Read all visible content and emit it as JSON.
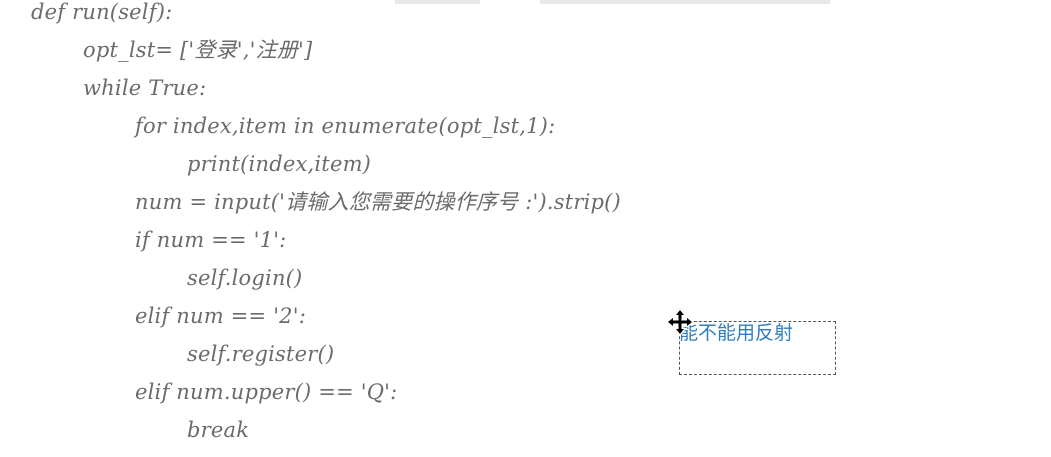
{
  "code_lines": [
    "def run(self):",
    "opt_lst= ['登录','注册']",
    "while True:",
    "for index,item in enumerate(opt_lst,1):",
    "print(index,item)",
    "num = input('请输入您需要的操作序号 :').strip()",
    "if num == '1':",
    "self.login()",
    "elif num == '2':",
    "self.register()",
    "elif num.upper() == 'Q':",
    "break"
  ],
  "annotation": {
    "text": "能不能用反射"
  },
  "icons": {
    "cursor": "move-cursor-icon"
  },
  "colors": {
    "code_text": "#6b6b6b",
    "annotation_text": "#2f7fc0"
  }
}
